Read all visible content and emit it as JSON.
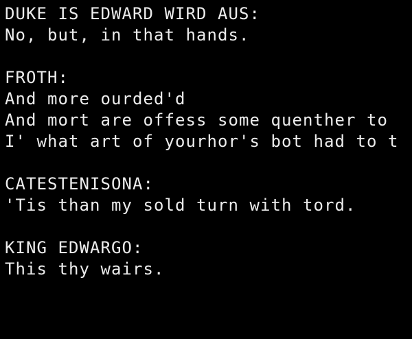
{
  "theme": {
    "background": "#000000",
    "foreground": "#ececec"
  },
  "terminal": {
    "lines": [
      "DUKE IS EDWARD WIRD AUS:",
      "No, but, in that hands.",
      "",
      "FROTH:",
      "And more ourded'd",
      "And mort are offess some quenther to",
      "I' what art of yourhor's bot had to t",
      "",
      "CATESTENISONA:",
      "'Tis than my sold turn with tord.",
      "",
      "KING EDWARGO:",
      "This thy wairs."
    ]
  }
}
